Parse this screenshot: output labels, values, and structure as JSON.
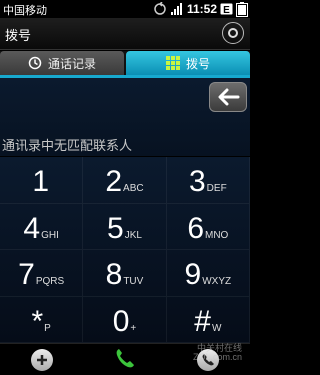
{
  "status_bar": {
    "carrier": "中国移动",
    "time": "11:52",
    "icons": [
      "sync-icon",
      "signal-icon",
      "email-icon",
      "battery-icon"
    ]
  },
  "title_bar": {
    "title": "拨号",
    "corner_icon": "menu-circle-icon"
  },
  "tabs": [
    {
      "label": "通话记录",
      "icon": "call-log-icon",
      "active": false
    },
    {
      "label": "拨号",
      "icon": "dialpad-icon",
      "active": true
    }
  ],
  "display": {
    "hint": "通讯录中无匹配联系人",
    "backspace_icon": "backspace-arrow-icon"
  },
  "keypad": {
    "keys": [
      {
        "num": "1",
        "letters": ""
      },
      {
        "num": "2",
        "letters": "ABC"
      },
      {
        "num": "3",
        "letters": "DEF"
      },
      {
        "num": "4",
        "letters": "GHI"
      },
      {
        "num": "5",
        "letters": "JKL"
      },
      {
        "num": "6",
        "letters": "MNO"
      },
      {
        "num": "7",
        "letters": "PQRS"
      },
      {
        "num": "8",
        "letters": "TUV"
      },
      {
        "num": "9",
        "letters": "WXYZ"
      },
      {
        "num": "*",
        "letters": "P"
      },
      {
        "num": "0",
        "letters": "+"
      },
      {
        "num": "#",
        "letters": "W"
      }
    ]
  },
  "bottom_bar": {
    "add_icon": "add-contact-icon",
    "call_icon": "call-icon",
    "video_icon": "video-call-icon"
  },
  "watermark": {
    "line1": "中关村在线",
    "line2": "ZOL.com.cn"
  },
  "colors": {
    "tab_active": "#17a9cf",
    "call_green": "#3cc43c",
    "background": "#0b1a2e"
  }
}
